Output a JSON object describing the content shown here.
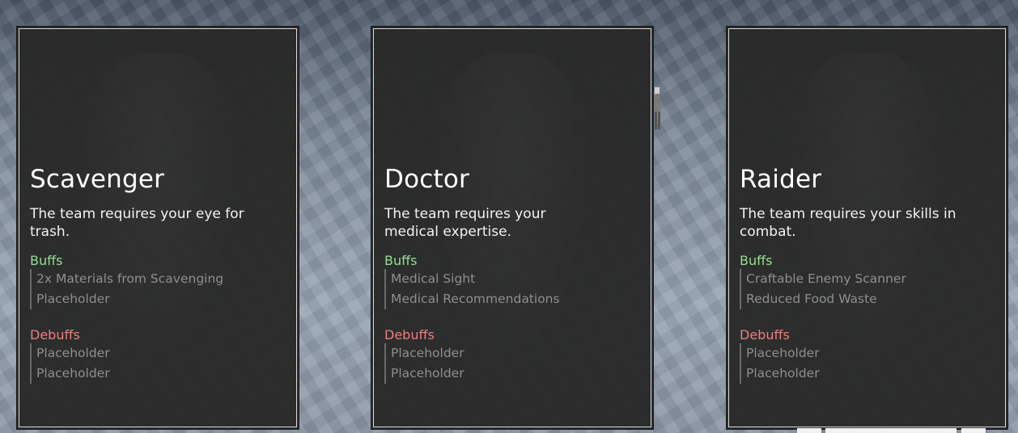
{
  "classes": [
    {
      "name": "Scavenger",
      "description": "The team requires your eye for trash.",
      "buffs_label": "Buffs",
      "buffs": [
        "2x Materials from Scavenging",
        "Placeholder"
      ],
      "debuffs_label": "Debuffs",
      "debuffs": [
        "Placeholder",
        "Placeholder"
      ]
    },
    {
      "name": "Doctor",
      "description": "The team requires your medical expertise.",
      "buffs_label": "Buffs",
      "buffs": [
        "Medical Sight",
        "Medical Recommendations"
      ],
      "debuffs_label": "Debuffs",
      "debuffs": [
        "Placeholder",
        "Placeholder"
      ]
    },
    {
      "name": "Raider",
      "description": "The team requires your skills in combat.",
      "buffs_label": "Buffs",
      "buffs": [
        "Craftable Enemy Scanner",
        "Reduced Food Waste"
      ],
      "debuffs_label": "Debuffs",
      "debuffs": [
        "Placeholder",
        "Placeholder"
      ]
    }
  ],
  "colors": {
    "buffs": "#92e08e",
    "debuffs": "#ef7d7d",
    "card_background": "#282828",
    "card_border": "#d9d9d9"
  }
}
